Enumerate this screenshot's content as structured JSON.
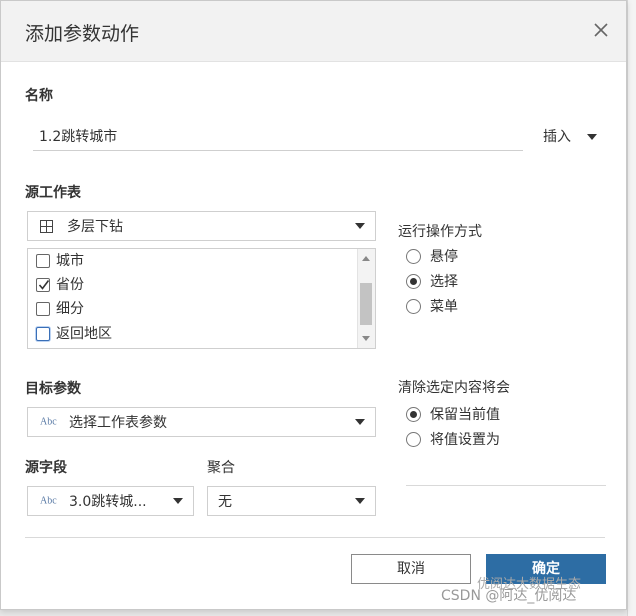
{
  "dialog": {
    "title": "添加参数动作"
  },
  "name_section": {
    "label": "名称",
    "value": "1.2跳转城市",
    "insert_label": "插入"
  },
  "source_sheet": {
    "label": "源工作表",
    "selected": "多层下钻",
    "items": [
      {
        "label": "城市",
        "checked": false
      },
      {
        "label": "省份",
        "checked": true
      },
      {
        "label": "细分",
        "checked": false
      },
      {
        "label": "返回地区",
        "checked": false
      }
    ]
  },
  "run_action": {
    "label": "运行操作方式",
    "options": [
      "悬停",
      "选择",
      "菜单"
    ],
    "selected": "选择"
  },
  "target_param": {
    "label": "目标参数",
    "abc": "Abc",
    "value": "选择工作表参数"
  },
  "clear_selection": {
    "label": "清除选定内容将会",
    "options": [
      "保留当前值",
      "将值设置为"
    ],
    "selected": "保留当前值"
  },
  "source_field": {
    "label": "源字段",
    "abc": "Abc",
    "value": "3.0跳转城..."
  },
  "aggregation": {
    "label": "聚合",
    "value": "无"
  },
  "buttons": {
    "cancel": "取消",
    "ok": "确定"
  },
  "watermark": {
    "text": "CSDN @阿达_优阅达",
    "logo": "优阅达大数据生态"
  },
  "icons": {
    "close": "close-icon",
    "sheet": "dashboard-grid-icon",
    "dropdown": "triangle-down-icon"
  }
}
